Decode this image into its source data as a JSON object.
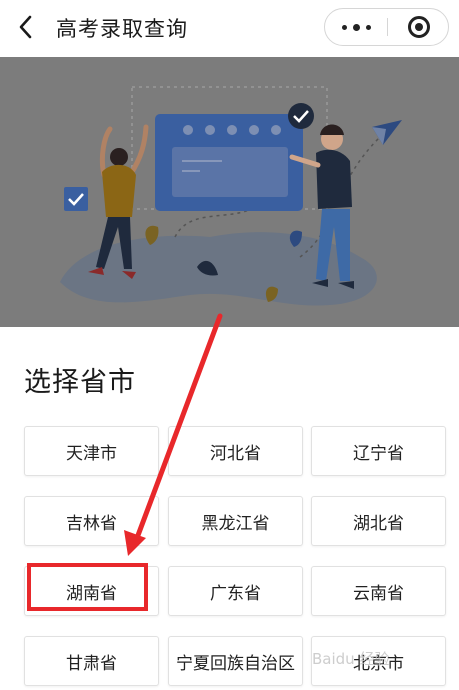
{
  "navbar": {
    "title": "高考录取查询",
    "back_icon": "chevron-left-icon",
    "more_icon": "more-dots-icon",
    "close_icon": "target-close-icon"
  },
  "banner": {
    "image": "people-with-browser-illustration"
  },
  "section": {
    "title": "选择省市"
  },
  "provinces": [
    {
      "label": "天津市"
    },
    {
      "label": "河北省"
    },
    {
      "label": "辽宁省"
    },
    {
      "label": "吉林省"
    },
    {
      "label": "黑龙江省"
    },
    {
      "label": "湖北省"
    },
    {
      "label": "湖南省"
    },
    {
      "label": "广东省"
    },
    {
      "label": "云南省"
    },
    {
      "label": "甘肃省"
    },
    {
      "label": "宁夏回族自治区"
    },
    {
      "label": "北京市"
    }
  ],
  "annotation": {
    "color": "#e8282b",
    "target": "湖南省"
  },
  "colors": {
    "overlay": "#7c7c7c",
    "accent_blue": "#3a5fa0"
  }
}
